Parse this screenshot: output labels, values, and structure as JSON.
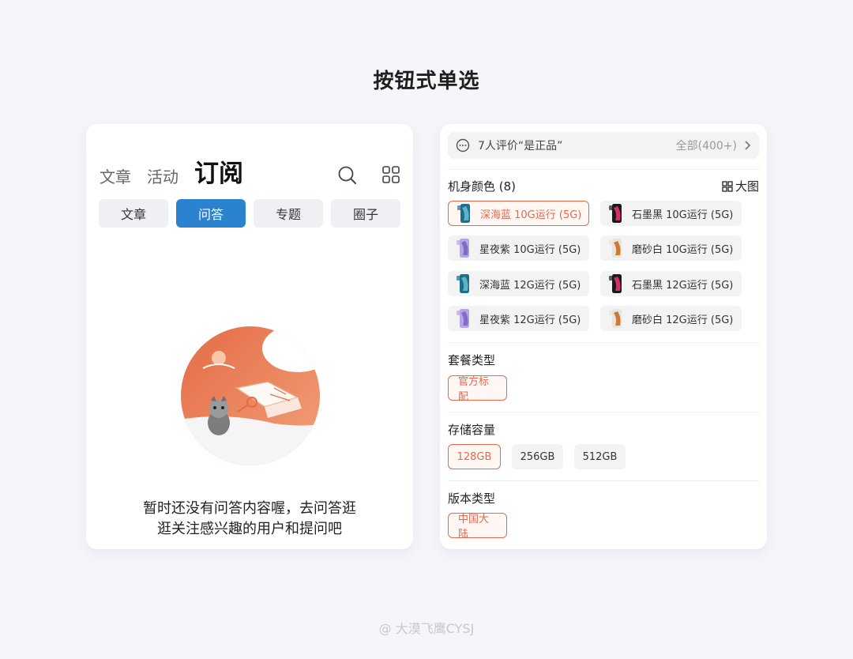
{
  "page": {
    "title": "按钮式单选",
    "watermark": "@ 大漠飞鹰CYSJ"
  },
  "left": {
    "top_tabs": [
      "文章",
      "活动",
      "订阅"
    ],
    "segments": [
      "文章",
      "问答",
      "专题",
      "圈子"
    ],
    "active_segment": "问答",
    "empty_line1": "暂时还没有问答内容喔，去问答逛",
    "empty_line2": "逛关注感兴趣的用户和提问吧"
  },
  "right": {
    "review_text": "7人评价“是正品”",
    "review_count": "全部(400+)",
    "color_title": "机身颜色 (8)",
    "big_image": "大图",
    "colors": [
      {
        "label": "深海蓝 10G运行 (5G)",
        "icon": "phone-blue",
        "selected": true
      },
      {
        "label": "石墨黑 10G运行 (5G)",
        "icon": "phone-black",
        "selected": false
      },
      {
        "label": "星夜紫 10G运行 (5G)",
        "icon": "phone-purple",
        "selected": false
      },
      {
        "label": "磨砂白 10G运行 (5G)",
        "icon": "phone-white",
        "selected": false
      },
      {
        "label": "深海蓝 12G运行 (5G)",
        "icon": "phone-blue",
        "selected": false
      },
      {
        "label": "石墨黑 12G运行 (5G)",
        "icon": "phone-black",
        "selected": false
      },
      {
        "label": "星夜紫 12G运行 (5G)",
        "icon": "phone-purple",
        "selected": false
      },
      {
        "label": "磨砂白 12G运行 (5G)",
        "icon": "phone-white",
        "selected": false
      }
    ],
    "package_title": "套餐类型",
    "package_options": [
      "官方标配"
    ],
    "storage_title": "存储容量",
    "storage_options": [
      "128GB",
      "256GB",
      "512GB"
    ],
    "version_title": "版本类型",
    "version_options": [
      "中国大陆"
    ]
  },
  "colors": {
    "accent": "#e8684a",
    "primary_blue": "#2b83d0",
    "illustration_orange": "#e57a4f"
  }
}
